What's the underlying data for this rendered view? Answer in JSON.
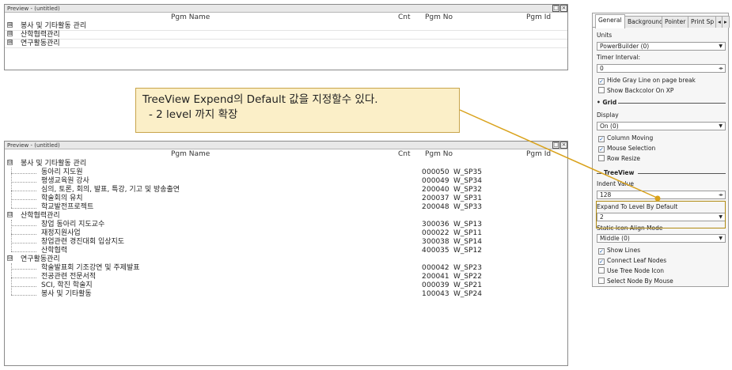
{
  "preview1": {
    "title": "Preview - (untitled)",
    "columns": {
      "pgm_name": "Pgm Name",
      "cnt": "Cnt",
      "pgm_no": "Pgm No",
      "pgm_id": "Pgm Id"
    },
    "rows": [
      {
        "expander": "⊞",
        "name": "봉사 및 기타활동 관리"
      },
      {
        "expander": "⊞",
        "name": "산학협력관리"
      },
      {
        "expander": "⊞",
        "name": "연구활동관리"
      }
    ]
  },
  "callout": {
    "line1": "TreeView Expend의 Default 값을 지정할수 있다.",
    "line2": "- 2 level 까지 확장"
  },
  "preview2": {
    "title": "Preview - (untitled)",
    "columns": {
      "pgm_name": "Pgm Name",
      "cnt": "Cnt",
      "pgm_no": "Pgm No",
      "pgm_id": "Pgm Id"
    },
    "groups": [
      {
        "expander": "⊟",
        "name": "봉사 및 기타활동 관리",
        "children": [
          {
            "name": "동아리 지도원",
            "cnt": "0",
            "no": "00050",
            "id": "W_SP35"
          },
          {
            "name": "평생교육원 강사",
            "cnt": "0",
            "no": "00049",
            "id": "W_SP34"
          },
          {
            "name": "심의, 토론, 회의, 발표, 특강, 기고 및 방송출연",
            "cnt": "2",
            "no": "00040",
            "id": "W_SP32"
          },
          {
            "name": "학술회의 유치",
            "cnt": "2",
            "no": "00037",
            "id": "W_SP31"
          },
          {
            "name": "학교발전프로젝트",
            "cnt": "2",
            "no": "00048",
            "id": "W_SP33"
          }
        ]
      },
      {
        "expander": "⊟",
        "name": "산학협력관리",
        "children": [
          {
            "name": "창업 동아리 지도교수",
            "cnt": "3",
            "no": "00036",
            "id": "W_SP13"
          },
          {
            "name": "재정지원사업",
            "cnt": "0",
            "no": "00022",
            "id": "W_SP11"
          },
          {
            "name": "창업관련 경진대회 입상지도",
            "cnt": "3",
            "no": "00038",
            "id": "W_SP14"
          },
          {
            "name": "산학협력",
            "cnt": "4",
            "no": "00035",
            "id": "W_SP12"
          }
        ]
      },
      {
        "expander": "⊟",
        "name": "연구활동관리",
        "children": [
          {
            "name": "학술발표회 기조강연 및 주제발표",
            "cnt": "0",
            "no": "00042",
            "id": "W_SP23"
          },
          {
            "name": "전공관련 전문서적",
            "cnt": "2",
            "no": "00041",
            "id": "W_SP22"
          },
          {
            "name": "SCI, 학진 학술지",
            "cnt": "0",
            "no": "00039",
            "id": "W_SP21"
          },
          {
            "name": "봉사 및 기타활동",
            "cnt": "1",
            "no": "00043",
            "id": "W_SP24"
          }
        ]
      }
    ]
  },
  "panel": {
    "tabs": [
      "General",
      "Background",
      "Pointer",
      "Print Sp"
    ],
    "units_label": "Units",
    "units_value": "PowerBuilder (0)",
    "timer_label": "Timer Interval:",
    "timer_value": "0",
    "hide_gray_line": "Hide Gray Line on page break",
    "show_backcolor": "Show Backcolor On XP",
    "grid_group": "Grid",
    "display_label": "Display",
    "display_value": "On (0)",
    "column_moving": "Column Moving",
    "mouse_selection": "Mouse Selection",
    "row_resize": "Row Resize",
    "treeview_group": "TreeView",
    "indent_label": "Indent Value",
    "indent_value": "128",
    "expand_label": "Expand To Level By Default",
    "expand_value": "2",
    "static_icon_label": "Static Icon Align Mode",
    "static_icon_value": "Middle (0)",
    "show_lines": "Show Lines",
    "connect_leaf": "Connect Leaf Nodes",
    "use_tree_icon": "Use Tree Node Icon",
    "select_by_mouse": "Select Node By Mouse"
  },
  "colors": {
    "callout_bg": "#fbefc8",
    "callout_border": "#c8a54b",
    "arrow": "#d9a21b"
  }
}
